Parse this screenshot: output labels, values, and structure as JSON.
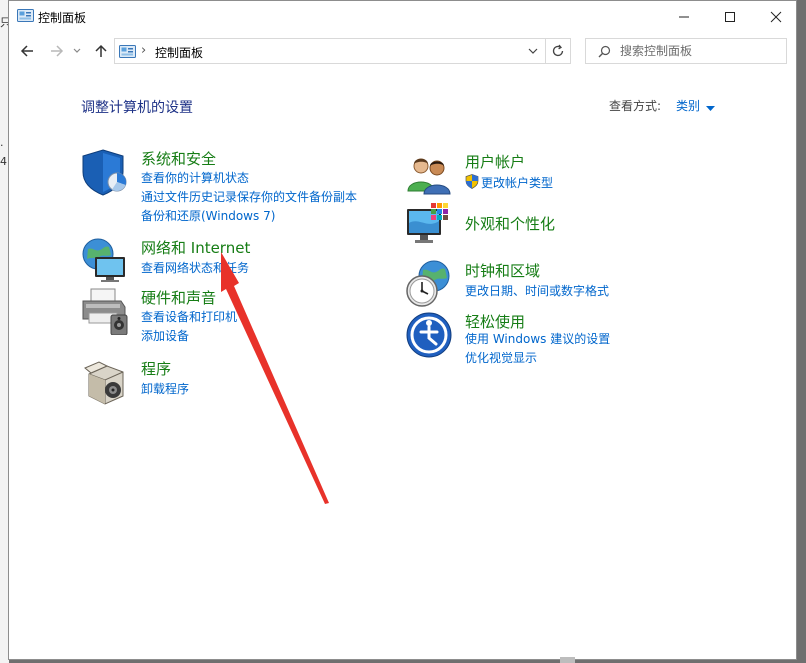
{
  "window": {
    "title": "控制面板"
  },
  "navbar": {
    "breadcrumb": "控制面板",
    "search_placeholder": "搜索控制面板"
  },
  "main": {
    "heading": "调整计算机的设置",
    "view_by_label": "查看方式:",
    "view_by_value": "类别"
  },
  "categories": {
    "system": {
      "title": "系统和安全",
      "links": [
        "查看你的计算机状态",
        "通过文件历史记录保存你的文件备份副本",
        "备份和还原(Windows 7)"
      ]
    },
    "network": {
      "title": "网络和 Internet",
      "links": [
        "查看网络状态和任务"
      ]
    },
    "hardware": {
      "title": "硬件和声音",
      "links": [
        "查看设备和打印机",
        "添加设备"
      ]
    },
    "programs": {
      "title": "程序",
      "links": [
        "卸载程序"
      ]
    },
    "accounts": {
      "title": "用户帐户",
      "links": [
        "更改帐户类型"
      ]
    },
    "appearance": {
      "title": "外观和个性化",
      "links": []
    },
    "clock": {
      "title": "时钟和区域",
      "links": [
        "更改日期、时间或数字格式"
      ]
    },
    "ease": {
      "title": "轻松使用",
      "links": [
        "使用 Windows 建议的设置",
        "优化视觉显示"
      ]
    }
  },
  "colors": {
    "category_title": "#167d15",
    "link": "#0066cc",
    "heading": "#1e3287",
    "annotation_arrow": "#e8322a"
  },
  "icons": [
    "control-panel-icon",
    "back-arrow-icon",
    "forward-arrow-icon",
    "chevron-down-icon",
    "up-arrow-icon",
    "refresh-icon",
    "search-icon",
    "shield-icon",
    "globe-monitor-icon",
    "printer-icon",
    "programs-box-icon",
    "users-icon",
    "uac-shield-icon",
    "display-palette-icon",
    "clock-globe-icon",
    "ease-of-access-icon"
  ]
}
